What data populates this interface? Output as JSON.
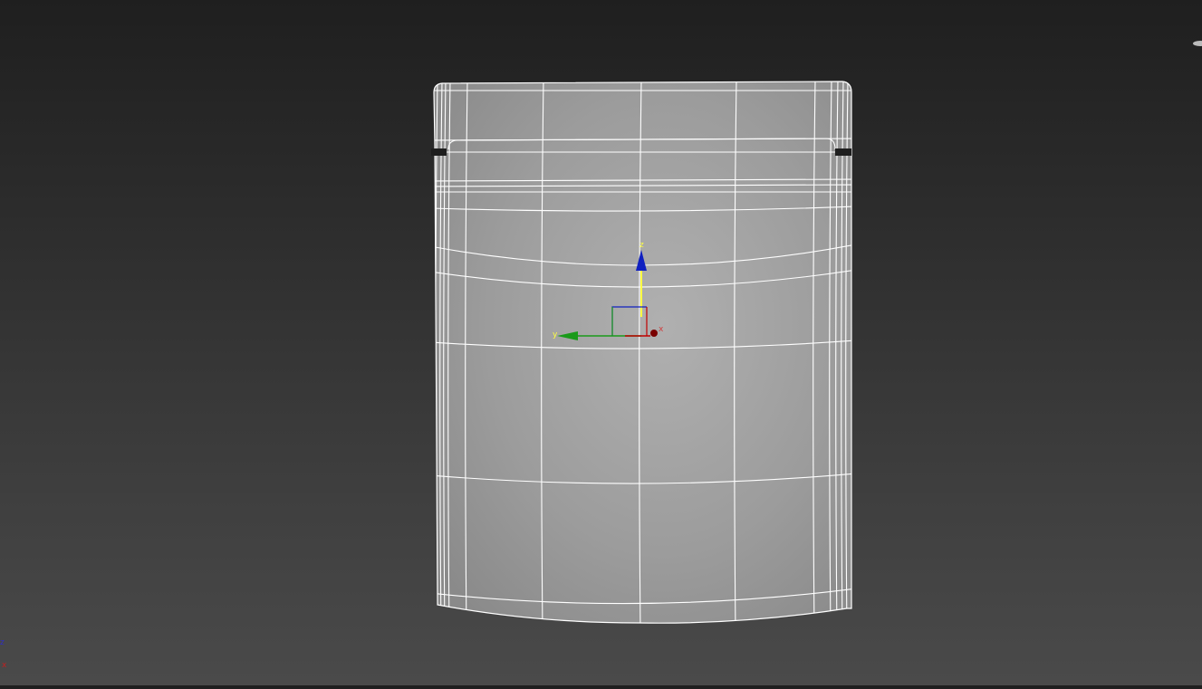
{
  "viewport": {
    "view": "front",
    "object": "pouch-mesh",
    "display_mode": "shaded-with-wireframe",
    "colors": {
      "mesh_fill": "#a3a3a3",
      "wire": "#ffffff",
      "x_axis": "#c00000",
      "y_axis": "#1a9a1a",
      "z_axis": "#1020c0",
      "z_shaft": "#ffff40"
    }
  },
  "gizmo": {
    "x_label": "x",
    "y_label": "y",
    "z_label": "z"
  },
  "world_axis": {
    "z_label": "z",
    "x_label": "x"
  }
}
